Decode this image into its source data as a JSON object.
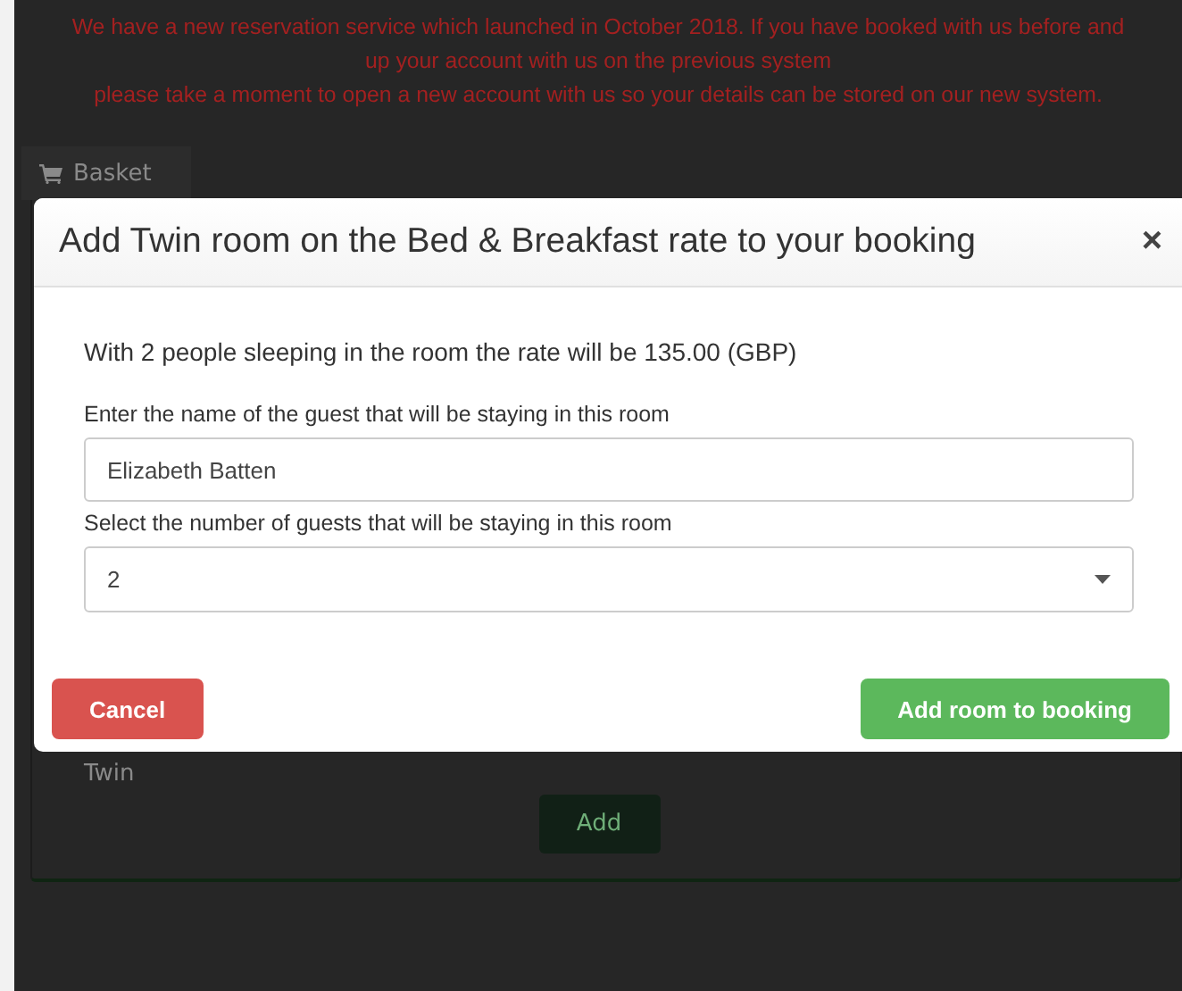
{
  "banner": {
    "lines": [
      "We have a new reservation service which launched in October 2018. If you have booked with us before and",
      "up your account with us on the previous system",
      "please take a moment to open a new account with us so your details can be stored on our new system."
    ]
  },
  "basket_tab": {
    "label": "Basket"
  },
  "background_panel": {
    "room_label": "Twin",
    "add_button": "Add"
  },
  "modal": {
    "title": "Add Twin room on the Bed & Breakfast rate to your booking",
    "close": "×",
    "rate_text": "With 2 people sleeping in the room the rate will be 135.00 (GBP)",
    "guest_name": {
      "label": "Enter the name of the guest that will be staying in this room",
      "value": "Elizabeth Batten"
    },
    "guest_count": {
      "label": "Select the number of guests that will be staying in this room",
      "value": "2"
    },
    "cancel_button": "Cancel",
    "confirm_button": "Add room to booking"
  }
}
